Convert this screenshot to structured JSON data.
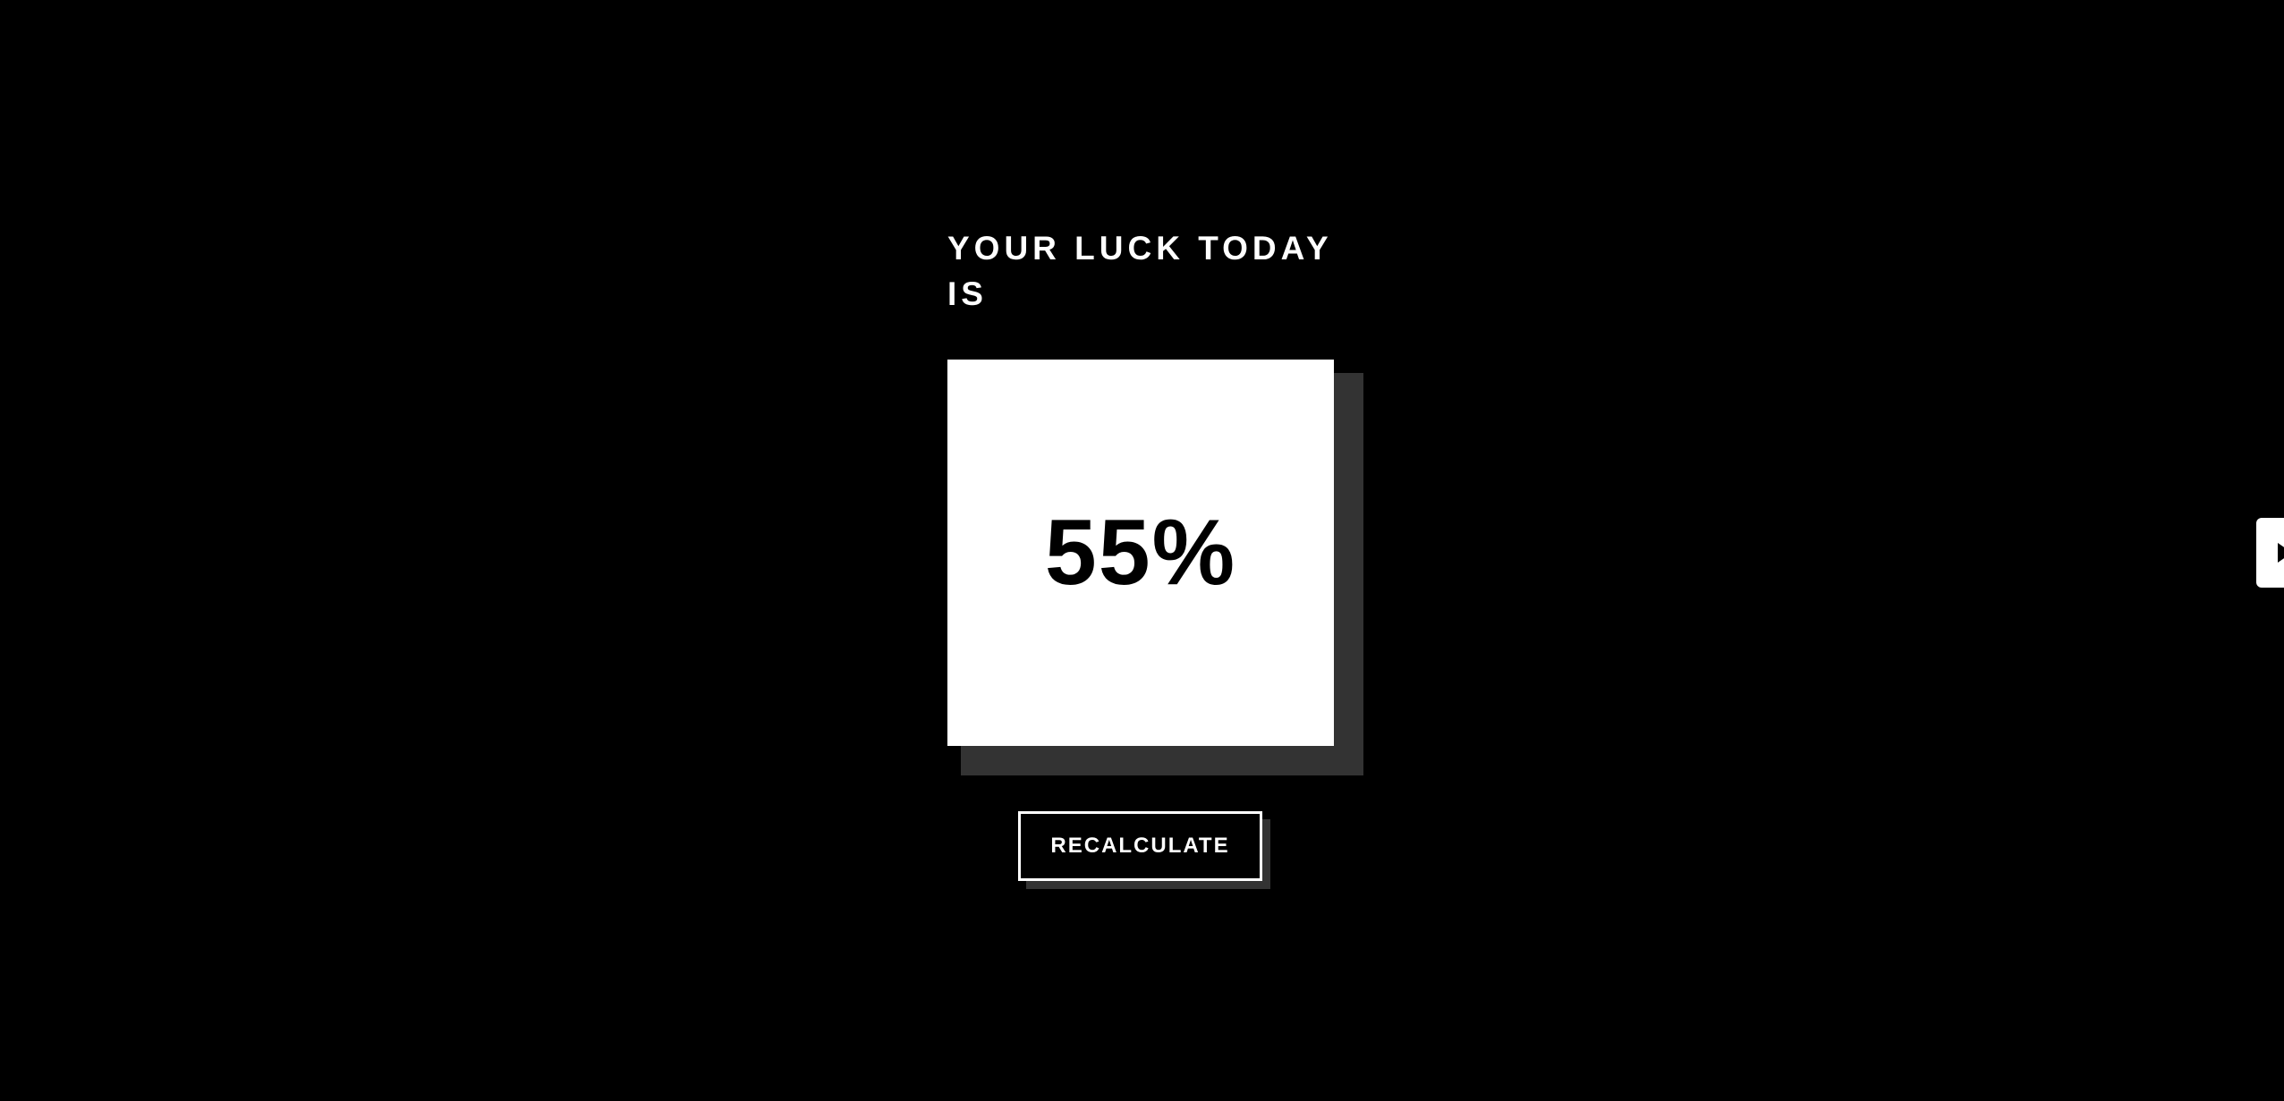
{
  "heading": "YOUR LUCK TODAY IS",
  "luck_value": "55%",
  "recalculate_label": "RECALCULATE",
  "edge_tab_icon": "play-icon",
  "colors": {
    "background": "#000000",
    "card": "#ffffff",
    "shadow": "#333333",
    "text_primary": "#ffffff",
    "text_on_card": "#000000"
  }
}
